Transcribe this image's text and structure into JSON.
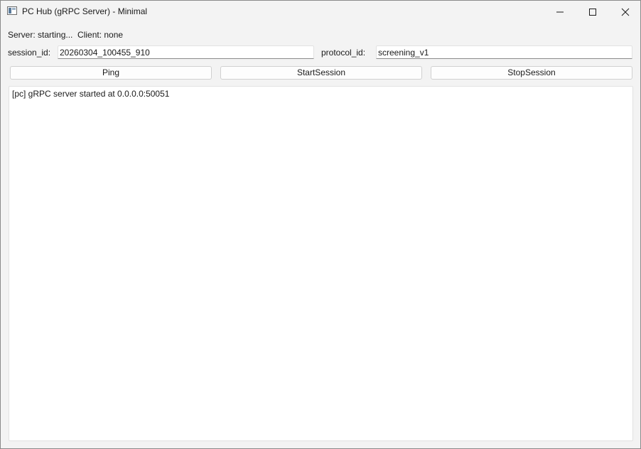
{
  "window": {
    "title": "PC Hub (gRPC Server) - Minimal"
  },
  "status": {
    "text": "Server: starting...  Client: none"
  },
  "fields": {
    "session_label": "session_id:",
    "session_value": "20260304_100455_910",
    "protocol_label": "protocol_id:",
    "protocol_value": "screening_v1"
  },
  "buttons": {
    "ping": "Ping",
    "start_session": "StartSession",
    "stop_session": "StopSession"
  },
  "log": {
    "lines": "[pc] gRPC server started at 0.0.0.0:50051"
  },
  "icons": {
    "app": "app-window-icon",
    "minimize": "minimize-icon",
    "maximize": "maximize-icon",
    "close": "close-icon"
  }
}
